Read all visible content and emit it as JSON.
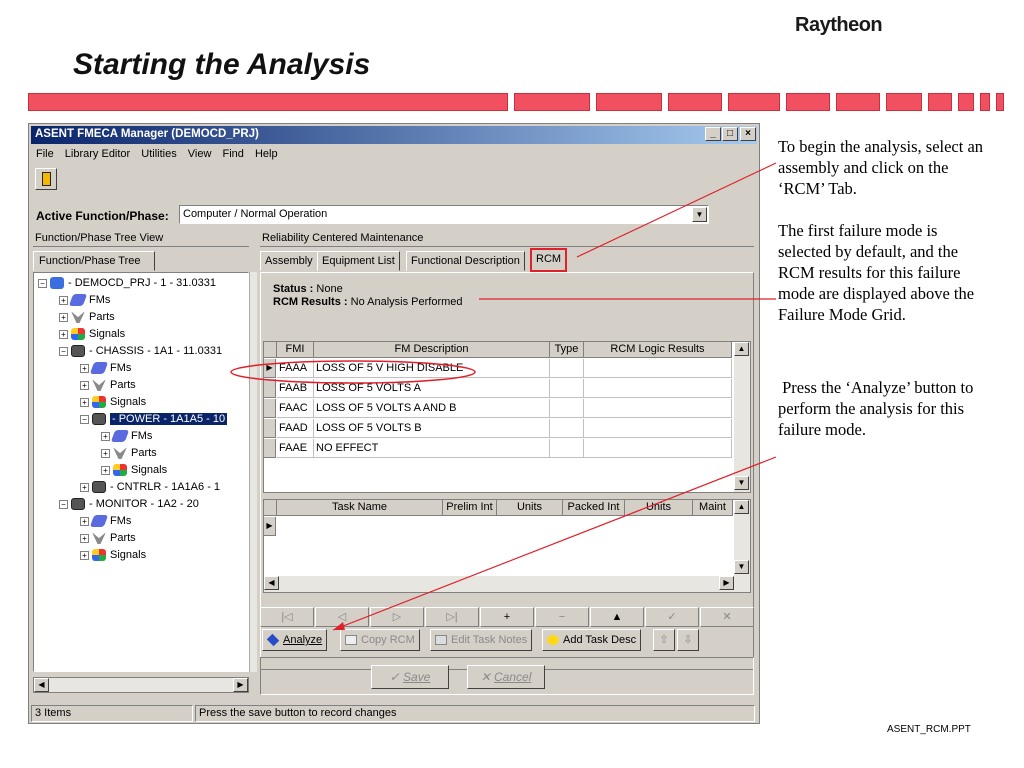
{
  "slide": {
    "brand": "Raytheon",
    "title": "Starting the Analysis",
    "footer_file": "ASENT_RCM.PPT",
    "accent_color": "#f05060",
    "explanation": [
      "To begin the analysis, select an assembly and click on the ‘RCM’ Tab.",
      "The first failure mode is selected by default, and the RCM results for this failure mode are displayed above the Failure Mode Grid.",
      " Press the ‘Analyze’ button to perform the analysis for this failure mode."
    ]
  },
  "window": {
    "title": "ASENT FMECA Manager (DEMOCD_PRJ)",
    "controls": {
      "minimize": "_",
      "maximize": "□",
      "close": "×"
    },
    "menu": [
      "File",
      "Library Editor",
      "Utilities",
      "View",
      "Find",
      "Help"
    ],
    "toolbar": {
      "exit_icon": "door-icon"
    },
    "active_function": {
      "label": "Active Function/Phase:",
      "value": "Computer / Normal Operation"
    },
    "left_panel": {
      "header": "Function/Phase Tree View",
      "tab": "Function/Phase Tree",
      "tree": [
        {
          "level": 0,
          "expander": "−",
          "icon": "root",
          "label": "- DEMOCD_PRJ - 1 - 31.0331"
        },
        {
          "level": 1,
          "expander": "+",
          "icon": "fm",
          "label": "FMs"
        },
        {
          "level": 1,
          "expander": "+",
          "icon": "parts",
          "label": "Parts"
        },
        {
          "level": 1,
          "expander": "+",
          "icon": "sig",
          "label": "Signals"
        },
        {
          "level": 1,
          "expander": "−",
          "icon": "asm",
          "label": "- CHASSIS - 1A1 - 11.0331"
        },
        {
          "level": 2,
          "expander": "+",
          "icon": "fm",
          "label": "FMs"
        },
        {
          "level": 2,
          "expander": "+",
          "icon": "parts",
          "label": "Parts"
        },
        {
          "level": 2,
          "expander": "+",
          "icon": "sig",
          "label": "Signals"
        },
        {
          "level": 2,
          "expander": "−",
          "icon": "asm",
          "label": "- POWER - 1A1A5 - 10",
          "selected": true
        },
        {
          "level": 3,
          "expander": "+",
          "icon": "fm",
          "label": "FMs"
        },
        {
          "level": 3,
          "expander": "+",
          "icon": "parts",
          "label": "Parts"
        },
        {
          "level": 3,
          "expander": "+",
          "icon": "sig",
          "label": "Signals"
        },
        {
          "level": 2,
          "expander": "+",
          "icon": "asm",
          "label": "- CNTRLR - 1A1A6 - 1"
        },
        {
          "level": 1,
          "expander": "−",
          "icon": "asm",
          "label": "- MONITOR - 1A2 - 20"
        },
        {
          "level": 2,
          "expander": "+",
          "icon": "fm",
          "label": "FMs"
        },
        {
          "level": 2,
          "expander": "+",
          "icon": "parts",
          "label": "Parts"
        },
        {
          "level": 2,
          "expander": "+",
          "icon": "sig",
          "label": "Signals"
        }
      ]
    },
    "right_panel": {
      "header": "Reliability Centered Maintenance",
      "tabs": [
        "Assembly",
        "Equipment List",
        "Functional Description",
        "RCM"
      ],
      "active_tab": "RCM",
      "status_label": "Status :",
      "status_value": "None",
      "results_label": "RCM Results :",
      "results_value": "No Analysis Performed",
      "fm_grid": {
        "columns": [
          "FMI",
          "FM Description",
          "Type",
          "RCM Logic Results"
        ],
        "rows": [
          [
            "FAAA",
            "LOSS OF 5 V HIGH DISABLE",
            "",
            ""
          ],
          [
            "FAAB",
            "LOSS OF 5 VOLTS A",
            "",
            ""
          ],
          [
            "FAAC",
            "LOSS OF 5 VOLTS A AND B",
            "",
            ""
          ],
          [
            "FAAD",
            "LOSS OF 5 VOLTS B",
            "",
            ""
          ],
          [
            "FAAE",
            "NO EFFECT",
            "",
            ""
          ]
        ]
      },
      "task_grid": {
        "columns": [
          "Task Name",
          "Prelim Int",
          "Units",
          "Packed Int",
          "Units",
          "Maint"
        ]
      },
      "nav_buttons": [
        "|◁",
        "◁",
        "▷",
        "▷|",
        "+",
        "−",
        "▲",
        "✓",
        "✕"
      ],
      "actions": {
        "analyze": "Analyze",
        "copy_rcm": "Copy RCM",
        "edit_task_notes": "Edit Task Notes",
        "add_task_desc": "Add Task Desc",
        "move_up": "⇧",
        "move_down": "⇩"
      },
      "save": "Save",
      "cancel": "Cancel"
    },
    "statusbar": {
      "items": "3 Items",
      "message": "Press the save button to record changes"
    }
  }
}
